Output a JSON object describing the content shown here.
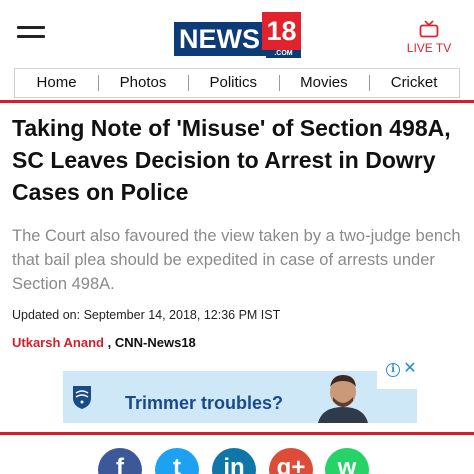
{
  "header": {
    "logo": {
      "word": "NEWS",
      "number": "18",
      "suffix": ".COM"
    },
    "live_tv_label": "LIVE TV",
    "icons": {
      "menu": "hamburger-menu-icon",
      "tv": "tv-icon"
    }
  },
  "nav": {
    "items": [
      {
        "label": "Home"
      },
      {
        "label": "Photos"
      },
      {
        "label": "Politics"
      },
      {
        "label": "Movies"
      },
      {
        "label": "Cricket"
      }
    ]
  },
  "article": {
    "headline": "Taking Note of 'Misuse' of Section 498A, SC Leaves Decision to Arrest in Dowry Cases on Police",
    "summary": "The Court also favoured the view taken by a two-judge bench that bail plea should be expedited in case of arrests under Section 498A.",
    "updated_label": "Updated on:",
    "updated_value": "September 14, 2018, 12:36 PM IST",
    "author": "Utkarsh Anand",
    "separator": ",",
    "source": "CNN-News18"
  },
  "ad": {
    "text": "Trimmer troubles?",
    "info_glyph": "i",
    "close_glyph": "✕"
  },
  "share": {
    "buttons": [
      {
        "name": "facebook",
        "glyph": "f"
      },
      {
        "name": "twitter",
        "glyph": "t"
      },
      {
        "name": "linkedin",
        "glyph": "in"
      },
      {
        "name": "google-plus",
        "glyph": "g+"
      },
      {
        "name": "whatsapp",
        "glyph": "w"
      }
    ]
  },
  "colors": {
    "brand_blue": "#0c3b77",
    "brand_red": "#e2222d",
    "accent_red": "#d41f2b",
    "summary_grey": "#8a8a8a",
    "ad_bg": "#cfe8f8"
  }
}
